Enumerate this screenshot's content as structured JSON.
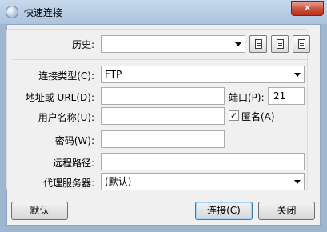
{
  "window": {
    "title": "快速连接",
    "close_symbol": "✕"
  },
  "history": {
    "label": "历史:",
    "value": ""
  },
  "connection_type": {
    "label": "连接类型(C):",
    "value": "FTP"
  },
  "address": {
    "label": "地址或 URL(D):",
    "value": ""
  },
  "port": {
    "label": "端口(P):",
    "value": "21"
  },
  "username": {
    "label": "用户名称(U):",
    "value": ""
  },
  "anonymous": {
    "label": "匿名(A)",
    "checked": true
  },
  "password": {
    "label": "密码(W):",
    "value": ""
  },
  "remote_path": {
    "label": "远程路径:",
    "value": ""
  },
  "proxy": {
    "label": "代理服务器:",
    "value": "(默认)"
  },
  "buttons": {
    "default": "默认",
    "connect": "连接(C)",
    "close": "关闭"
  }
}
